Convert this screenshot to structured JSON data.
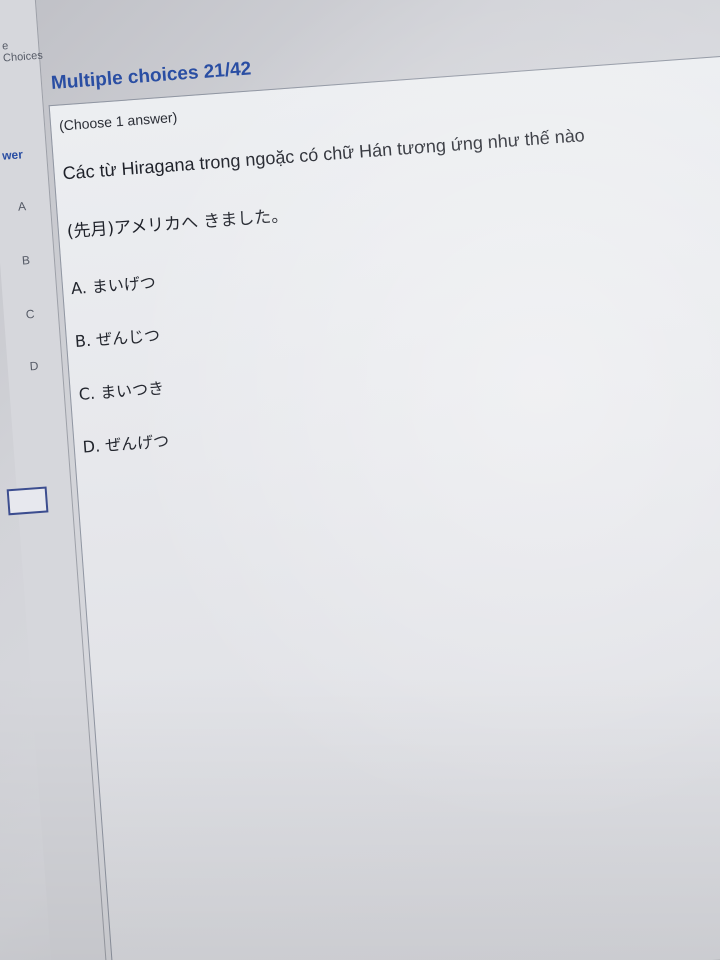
{
  "sidebar": {
    "title": "e Choices",
    "answer_label": "wer",
    "options": [
      "A",
      "B",
      "C",
      "D"
    ]
  },
  "header": {
    "title": "Multiple choices 21/42"
  },
  "question": {
    "instruction": "(Choose 1 answer)",
    "text": "Các từ Hiragana trong ngoặc có chữ Hán tương ứng như thế nào",
    "sentence": "(先月)アメリカへ きました。",
    "options": [
      "A. まいげつ",
      "B. ぜんじつ",
      "C. まいつき",
      "D. ぜんげつ"
    ]
  },
  "colors": {
    "accent": "#2a4ea3",
    "panel": "#e7e8ec",
    "text": "#1e2129"
  }
}
